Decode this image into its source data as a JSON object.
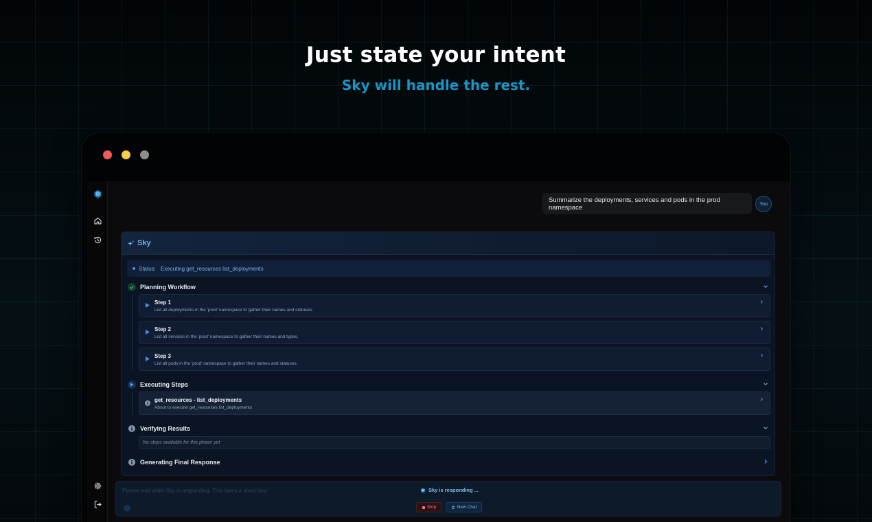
{
  "hero": {
    "title": "Just state your intent",
    "subtitle": "Sky will handle the rest."
  },
  "window": {
    "traffic_lights": [
      "#ef5a5a",
      "#f5cf47",
      "#8e8e8e"
    ]
  },
  "sidebar": {
    "logo_icon": "sky-logo-icon",
    "items": [
      {
        "name": "home",
        "icon": "home-icon"
      },
      {
        "name": "history",
        "icon": "history-icon"
      }
    ],
    "bottom_items": [
      {
        "name": "settings",
        "icon": "gear-icon"
      },
      {
        "name": "logout",
        "icon": "logout-icon"
      }
    ]
  },
  "chat": {
    "user_message": "Summarize the deployments, services and pods in the prod namespace",
    "user_avatar": "You",
    "assistant_name": "Sky",
    "status_label": "Status:",
    "status_value": "Executing get_resources list_deployments",
    "phases": {
      "planning": {
        "label": "Planning Workflow",
        "state": "done",
        "steps": [
          {
            "title": "Step 1",
            "desc": "List all deployments in the 'prod' namespace to gather their names and statuses."
          },
          {
            "title": "Step 2",
            "desc": "List all services in the 'prod' namespace to gather their names and types."
          },
          {
            "title": "Step 3",
            "desc": "List all pods in the 'prod' namespace to gather their names and statuses."
          }
        ]
      },
      "executing": {
        "label": "Executing Steps",
        "state": "active",
        "items": [
          {
            "title": "get_resources - list_deployments",
            "desc": "About to execute get_resources list_deployments"
          }
        ]
      },
      "verifying": {
        "label": "Verifying Results",
        "state": "pending",
        "empty_note": "No steps available for this phase yet"
      },
      "generating": {
        "label": "Generating Final Response",
        "state": "pending"
      }
    }
  },
  "composer": {
    "placeholder": "Please wait while Sky is responding. This takes a short time",
    "responding_text": "Sky is responding ...",
    "stop_label": "Stop",
    "new_chat_label": "New Chat"
  },
  "colors": {
    "accent": "#1796c8",
    "status_blue": "#79b4f0",
    "success": "#2fb36a",
    "stop_red": "#f0727a"
  }
}
